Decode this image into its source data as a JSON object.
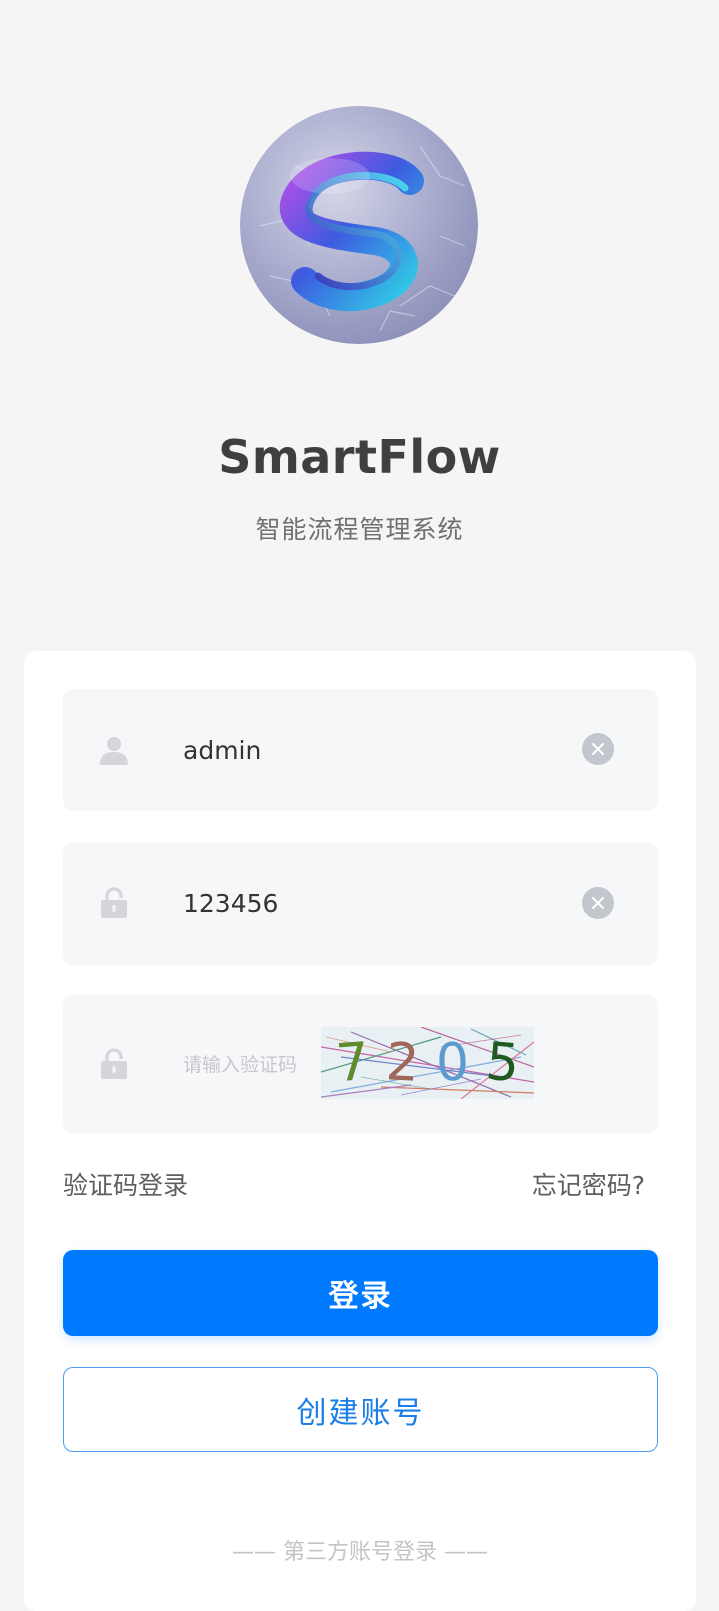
{
  "app": {
    "title": "SmartFlow",
    "subtitle": "智能流程管理系统"
  },
  "form": {
    "username_value": "admin",
    "password_value": "123456",
    "captcha_placeholder": "请输入验证码",
    "captcha_chars": [
      "7",
      "2",
      "0",
      "5"
    ],
    "captcha_colors": [
      "#5f8a2e",
      "#a0665a",
      "#5b9bd0",
      "#1f5a1f"
    ]
  },
  "links": {
    "sms_login": "验证码登录",
    "forgot_password": "忘记密码?"
  },
  "buttons": {
    "login": "登录",
    "register": "创建账号"
  },
  "divider": {
    "third_party": "—— 第三方账号登录 ——"
  },
  "colors": {
    "primary": "#007aff",
    "background": "#f5f5f5",
    "field_bg": "#f6f7f9"
  },
  "icons": {
    "logo": "smartflow-logo",
    "username": "user-icon",
    "password": "lock-icon",
    "captcha": "lock-icon",
    "clear": "clear-icon"
  }
}
